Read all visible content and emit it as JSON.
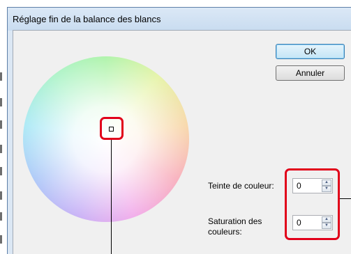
{
  "window": {
    "title": "Réglage fin de la balance des blancs"
  },
  "buttons": {
    "ok_label": "OK",
    "cancel_label": "Annuler"
  },
  "fields": {
    "hue_label": "Teinte de couleur:",
    "hue_value": "0",
    "saturation_label_line1": "Saturation des",
    "saturation_label_line2": "couleurs:",
    "saturation_value": "0"
  },
  "spinner_icons": {
    "up": "up-arrow-icon",
    "down": "down-arrow-icon"
  },
  "colors": {
    "callout": "#e1001a",
    "default_button_border": "#3c7fb1",
    "window_frame": "#dbe7f4",
    "client_bg": "#f0f0f0"
  }
}
